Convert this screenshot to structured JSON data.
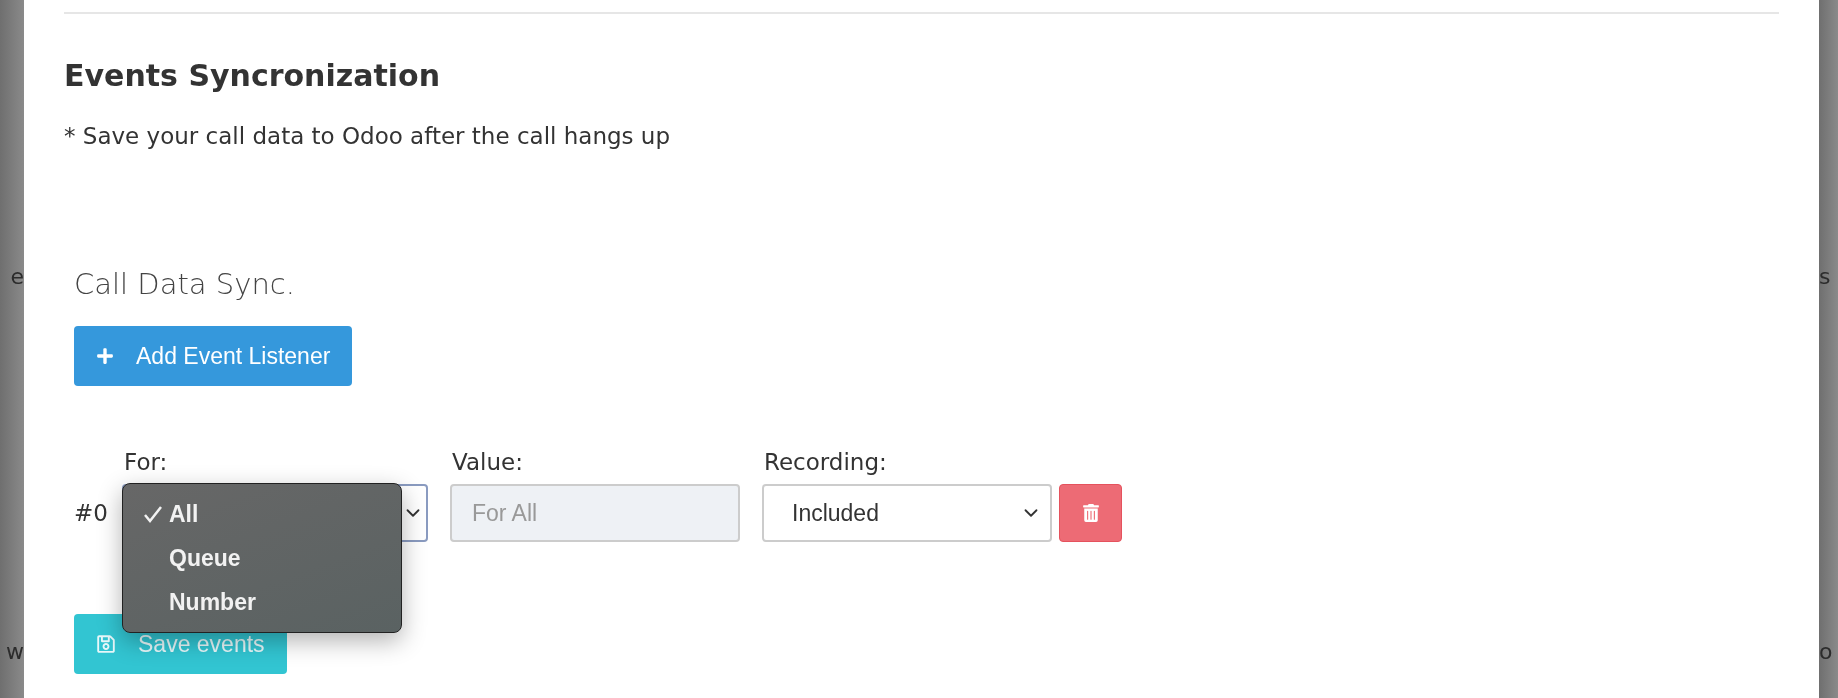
{
  "background": {
    "left_texts": [
      "e",
      "w"
    ],
    "right_texts": [
      "s",
      "o"
    ]
  },
  "section": {
    "title": "Events Syncronization",
    "note": "* Save your call data to Odoo after the call hangs up"
  },
  "sync": {
    "heading": "Call Data Sync.",
    "add_button": "Add Event Listener"
  },
  "listeners": [
    {
      "index": "#0",
      "for_label": "For:",
      "value_label": "Value:",
      "value_placeholder": "For All",
      "recording_label": "Recording:",
      "recording_value": "Included"
    }
  ],
  "for_menu": {
    "options": [
      {
        "label": "All",
        "selected": true
      },
      {
        "label": "Queue",
        "selected": false
      },
      {
        "label": "Number",
        "selected": false
      }
    ]
  },
  "save_button": "Save events"
}
